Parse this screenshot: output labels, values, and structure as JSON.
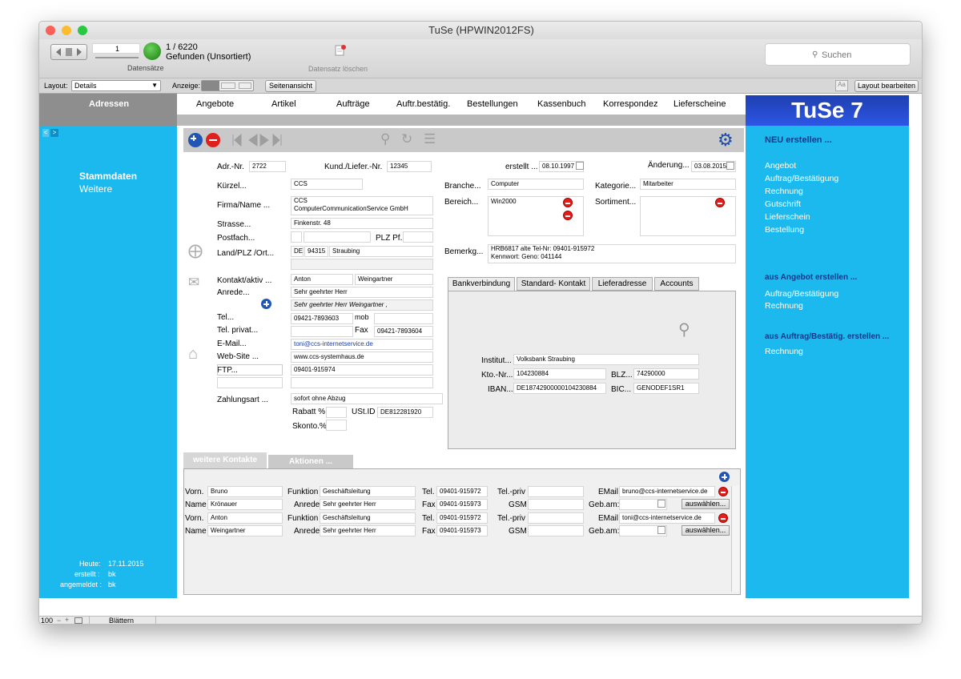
{
  "window": {
    "title": "TuSe (HPWIN2012FS)"
  },
  "toolbar": {
    "record_input": "1",
    "record_count": "1 / 6220",
    "found_status": "Gefunden (Unsortiert)",
    "datensaetze": "Datensätze",
    "delete_label": "Datensatz löschen",
    "search_placeholder": "Suchen"
  },
  "layoutbar": {
    "layout_label": "Layout:",
    "layout_value": "Details",
    "view_label": "Anzeige:",
    "page_view": "Seitenansicht",
    "edit_layout": "Layout bearbeiten"
  },
  "nav": {
    "active": "Adressen",
    "items": [
      "Angebote",
      "Artikel",
      "Aufträge",
      "Auftr.bestätig.",
      "Bestellungen",
      "Kassenbuch",
      "Korrespondez",
      "Lieferscheine"
    ],
    "logo": "TuSe 7"
  },
  "left": {
    "stammdaten": "Stammdaten",
    "weitere": "Weitere",
    "heute_label": "Heute:",
    "heute": "17.11.2015",
    "erstellt_label": "erstellt :",
    "erstellt": "bk",
    "angemeldet_label": "angemeldet :",
    "angemeldet": "bk"
  },
  "form": {
    "adrnr_label": "Adr.-Nr.",
    "adrnr": "2722",
    "kundnr_label": "Kund./Liefer.-Nr.",
    "kundnr": "12345",
    "erstellt_label": "erstellt ...",
    "erstellt": "08.10.1997",
    "aenderung_label": "Änderung...",
    "aenderung": "03.08.2015",
    "kuerzel_label": "Kürzel...",
    "kuerzel": "CCS",
    "firma_label": "Firma/Name ...",
    "firma1": "CCS",
    "firma2": "ComputerCommunicationService GmbH",
    "strasse_label": "Strasse...",
    "strasse": "Finkenstr. 48",
    "postfach_label": "Postfach...",
    "plzpf_label": "PLZ Pf.",
    "land_label": "Land/PLZ /Ort...",
    "land": "DE",
    "plz": "94315",
    "ort": "Straubing",
    "kontakt_label": "Kontakt/aktiv ...",
    "vorname": "Anton",
    "nachname": "Weingartner",
    "anrede_label": "Anrede...",
    "anrede": "Sehr geehrter Herr",
    "anrede_full": "Sehr geehrter Herr  Weingartner ,",
    "tel_label": "Tel...",
    "tel": "09421-7893603",
    "mob_label": "mob",
    "telpriv_label": "Tel. privat...",
    "fax_label": "Fax",
    "fax": "09421-7893604",
    "email_label": "E-Mail...",
    "email": "toni@ccs-internetservice.de",
    "web_label": "Web-Site ...",
    "web": "www.ccs-systemhaus.de",
    "ftp_label": "FTP...",
    "ftp": "09401-915974",
    "zahlung_label": "Zahlungsart ...",
    "zahlung": "sofort ohne Abzug",
    "rabatt_label": "Rabatt %",
    "ustid_label": "USt.ID",
    "ustid": "DE812281920",
    "skonto_label": "Skonto.%",
    "branche_label": "Branche...",
    "branche": "Computer",
    "kategorie_label": "Kategorie...",
    "kategorie": "Mitarbeiter",
    "bereich_label": "Bereich...",
    "bereich": "Win2000",
    "sortiment_label": "Sortiment...",
    "bemerk_label": "Bemerkg...",
    "bemerk1": "HRB6817    alte Tel-Nr: 09401-915972",
    "bemerk2": "Kennwort: Geno: 041144"
  },
  "banktabs": [
    "Bankverbindung",
    "Standard- Kontakt",
    "Lieferadresse",
    "Accounts"
  ],
  "bank": {
    "institut_label": "Institut...",
    "institut": "Volksbank Straubing",
    "kto_label": "Kto.-Nr...",
    "kto": "104230884",
    "blz_label": "BLZ...",
    "blz": "74290000",
    "iban_label": "IBAN...",
    "iban": "DE18742900000104230884",
    "bic_label": "BIC...",
    "bic": "GENODEF1SR1"
  },
  "bottomtabs": [
    "weitere Kontakte",
    "Aktionen ..."
  ],
  "contactlabels": {
    "vorn": "Vorn.",
    "name": "Name",
    "funktion": "Funktion",
    "anrede": "Anrede",
    "tel": "Tel.",
    "fax": "Fax",
    "telpriv": "Tel.-priv",
    "gsm": "GSM",
    "email": "EMail",
    "gebam": "Geb.am:",
    "auswaehlen": "auswählen..."
  },
  "contacts": [
    {
      "vorname": "Bruno",
      "name": "Krönauer",
      "funktion": "Geschäftsleitung",
      "anrede": "Sehr geehrter Herr",
      "tel": "09401-915972",
      "fax": "09401-915973",
      "email": "bruno@ccs-internetservice.de"
    },
    {
      "vorname": "Anton",
      "name": "Weingartner",
      "funktion": "Geschäftsleitung",
      "anrede": "Sehr geehrter Herr",
      "tel": "09401-915972",
      "fax": "09401-915973",
      "email": "toni@ccs-internetservice.de"
    }
  ],
  "right": {
    "neu": "NEU erstellen ...",
    "neu_items": [
      "Angebot",
      "Auftrag/Bestätigung",
      "Rechnung",
      "Gutschrift",
      "Lieferschein",
      "Bestellung"
    ],
    "aus_angebot": "aus Angebot erstellen ...",
    "aus_angebot_items": [
      "Auftrag/Bestätigung",
      "Rechnung"
    ],
    "aus_auftrag": "aus Auftrag/Bestätig. erstellen ...",
    "aus_auftrag_items": [
      "Rechnung"
    ]
  },
  "status": {
    "zoom": "100",
    "mode": "Blättern"
  }
}
